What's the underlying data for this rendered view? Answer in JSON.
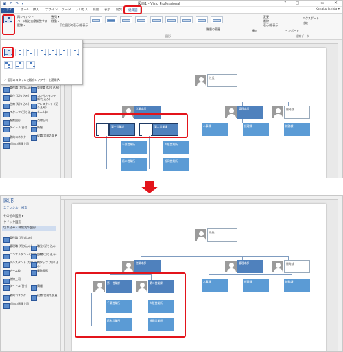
{
  "titlebar": {
    "title": "図面1 - Visio Professional"
  },
  "tabs": [
    "ファイル",
    "ホーム",
    "挿入",
    "デザイン",
    "データ",
    "プロセス",
    "校閲",
    "表示",
    "開発",
    "組織図"
  ],
  "user": "Kanako Ishida ▾",
  "ribbon": {
    "cmd1": "再レイアウト",
    "cmd2": "ページ幅に自動調整する",
    "cmd3": "配線 ▾",
    "cmd4": "整列 ▾",
    "cmd5": "移動 ▾",
    "cmd6": "下位図形の表示/非表示",
    "group_shapes": "図形",
    "cmd7": "階層の変更",
    "cmd8": "挿入",
    "cmd9": "変更",
    "cmd10": "削除",
    "cmd11": "表示/非表示",
    "cmd12": "インポート",
    "cmd13": "エクスポート",
    "cmd14": "比較",
    "group_data": "組織データ"
  },
  "dropdown": {
    "apply_label": "✓ 図形のスタイルに既存レイアウトを適用(A)"
  },
  "pane": {
    "title": "図形",
    "links": [
      "ステンシル",
      "検索"
    ],
    "more": "その他の図形 ▸",
    "quick": "クイック図形",
    "selected": "切り込み - 職階別の図形",
    "stencils": [
      "重役職 (切り込み)",
      "管理職 (切り込み)",
      "職位 (切り込み)",
      "コンサルタント (切り込み)",
      "空席 (切り込み)",
      "アシスタント (切り込み)",
      "スタッフ (切り込み)",
      "チーム枠",
      "複数図形",
      "点線上司",
      "タイトル/日付",
      "情報",
      "動的コネクタ",
      "役職/名前の変更",
      "追加の画像上司"
    ]
  },
  "org": {
    "top": "社長",
    "row2": [
      "営業本部",
      "管理本部",
      "開発部"
    ],
    "sub1": [
      "第一営業課",
      "第二営業課"
    ],
    "sub2": [
      "人事課",
      "経理課",
      "総務課"
    ],
    "sub3": [
      "千葉営業所",
      "大阪営業所",
      "栃木営業所",
      "福岡営業所"
    ]
  },
  "colors": {
    "accent": "#2b579a",
    "highlight": "#e3141b",
    "node": "#4f81bd"
  }
}
